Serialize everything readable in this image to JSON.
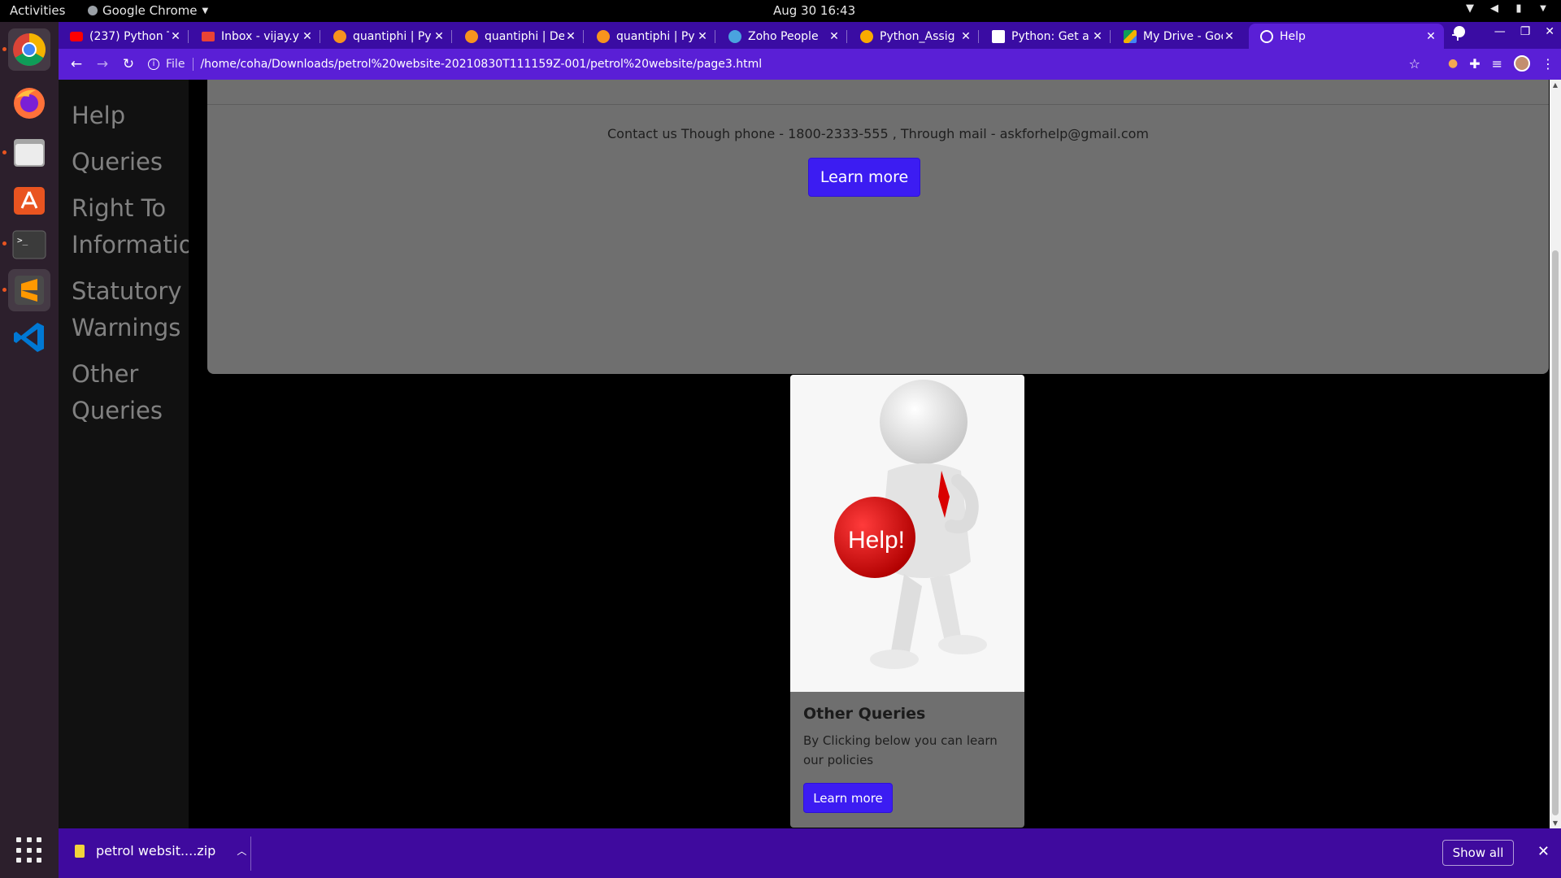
{
  "system": {
    "activities": "Activities",
    "app_name": "Google Chrome",
    "clock": "Aug 30  16:43"
  },
  "tabs": [
    {
      "title": "(237) Python T",
      "icon": "youtube-icon",
      "color": "#ff0000"
    },
    {
      "title": "Inbox - vijay.y",
      "icon": "gmail-icon",
      "color": "#ea4335"
    },
    {
      "title": "quantiphi | Py",
      "icon": "quantiphi-icon",
      "color": "#f7931e"
    },
    {
      "title": "quantiphi | De",
      "icon": "quantiphi-icon",
      "color": "#f7931e"
    },
    {
      "title": "quantiphi | Py",
      "icon": "quantiphi-icon",
      "color": "#f7931e"
    },
    {
      "title": "Zoho People",
      "icon": "zoho-icon",
      "color": "#4aa3df"
    },
    {
      "title": "Python_Assig",
      "icon": "colab-icon",
      "color": "#f9ab00"
    },
    {
      "title": "Python: Get a",
      "icon": "w3-icon",
      "color": "#ffffff"
    },
    {
      "title": "My Drive - Goo",
      "icon": "drive-icon",
      "color": "#0f9d58"
    },
    {
      "title": "Help",
      "icon": "globe-icon",
      "color": "#ffffff",
      "active": true
    }
  ],
  "address": {
    "scheme": "File",
    "url": "/home/coha/Downloads/petrol%20website-20210830T111159Z-001/petrol%20website/page3.html"
  },
  "sidenav": {
    "items": [
      "Help",
      "Queries",
      "Right To Information",
      "Statutory Warnings",
      "Other Queries"
    ]
  },
  "jumbotron": {
    "contact": "Contact us Though phone - 1800-2333-555 , Through mail - askforhelp@gmail.com",
    "button": "Learn more"
  },
  "card": {
    "image_text": "Help!",
    "title": "Other Queries",
    "text": "By Clicking below you can learn our policies",
    "button": "Learn more"
  },
  "downloads": {
    "file": "petrol websit....zip",
    "show_all": "Show all"
  },
  "colors": {
    "tab_strip": "#3a0ca3",
    "toolbar": "#5a1fd6",
    "primary_button": "#3c1cf2",
    "download_bar": "#3f0a9e"
  }
}
